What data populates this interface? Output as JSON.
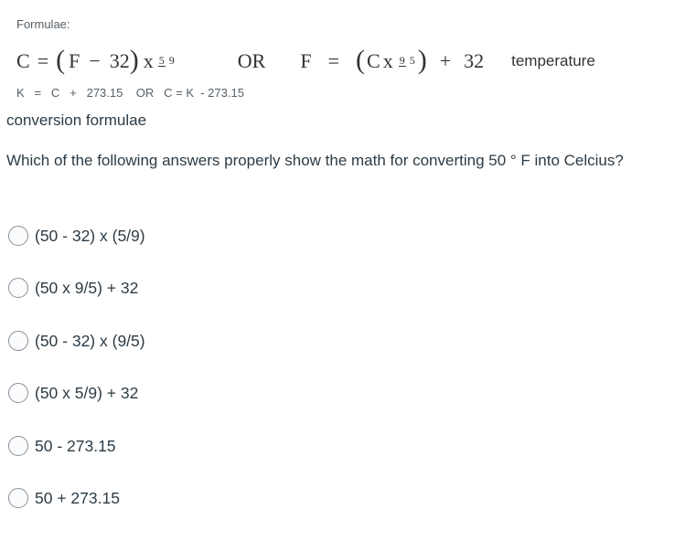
{
  "formulae_label": "Formulae:",
  "formula_c": {
    "lhs": "C",
    "eq": "=",
    "open": "(",
    "var": "F",
    "minus": "−",
    "const": "32",
    "close": ")",
    "times": "x",
    "frac_num": "5",
    "frac_den": "9"
  },
  "or_word": "OR",
  "formula_f": {
    "lhs": "F",
    "eq": "=",
    "open": "(",
    "var": "C",
    "times": "x",
    "frac_num": "9",
    "frac_den": "5",
    "close": ")",
    "plus": "+",
    "const": "32"
  },
  "temperature_word": "temperature",
  "kelvin_line": "K   =   C   +   273.15    OR   C = K  - 273.15",
  "conversion_line": "conversion formulae",
  "question": "Which of the following answers properly show the math for converting 50 ° F into Celcius?",
  "answers": [
    {
      "label": "(50 - 32) x (5/9)",
      "selected": false
    },
    {
      "label": "(50 x 9/5) + 32",
      "selected": false
    },
    {
      "label": "(50 - 32) x (9/5)",
      "selected": false
    },
    {
      "label": "(50 x 5/9) + 32",
      "selected": false
    },
    {
      "label": "50 - 273.15",
      "selected": false
    },
    {
      "label": "50 + 273.15",
      "selected": false
    }
  ]
}
